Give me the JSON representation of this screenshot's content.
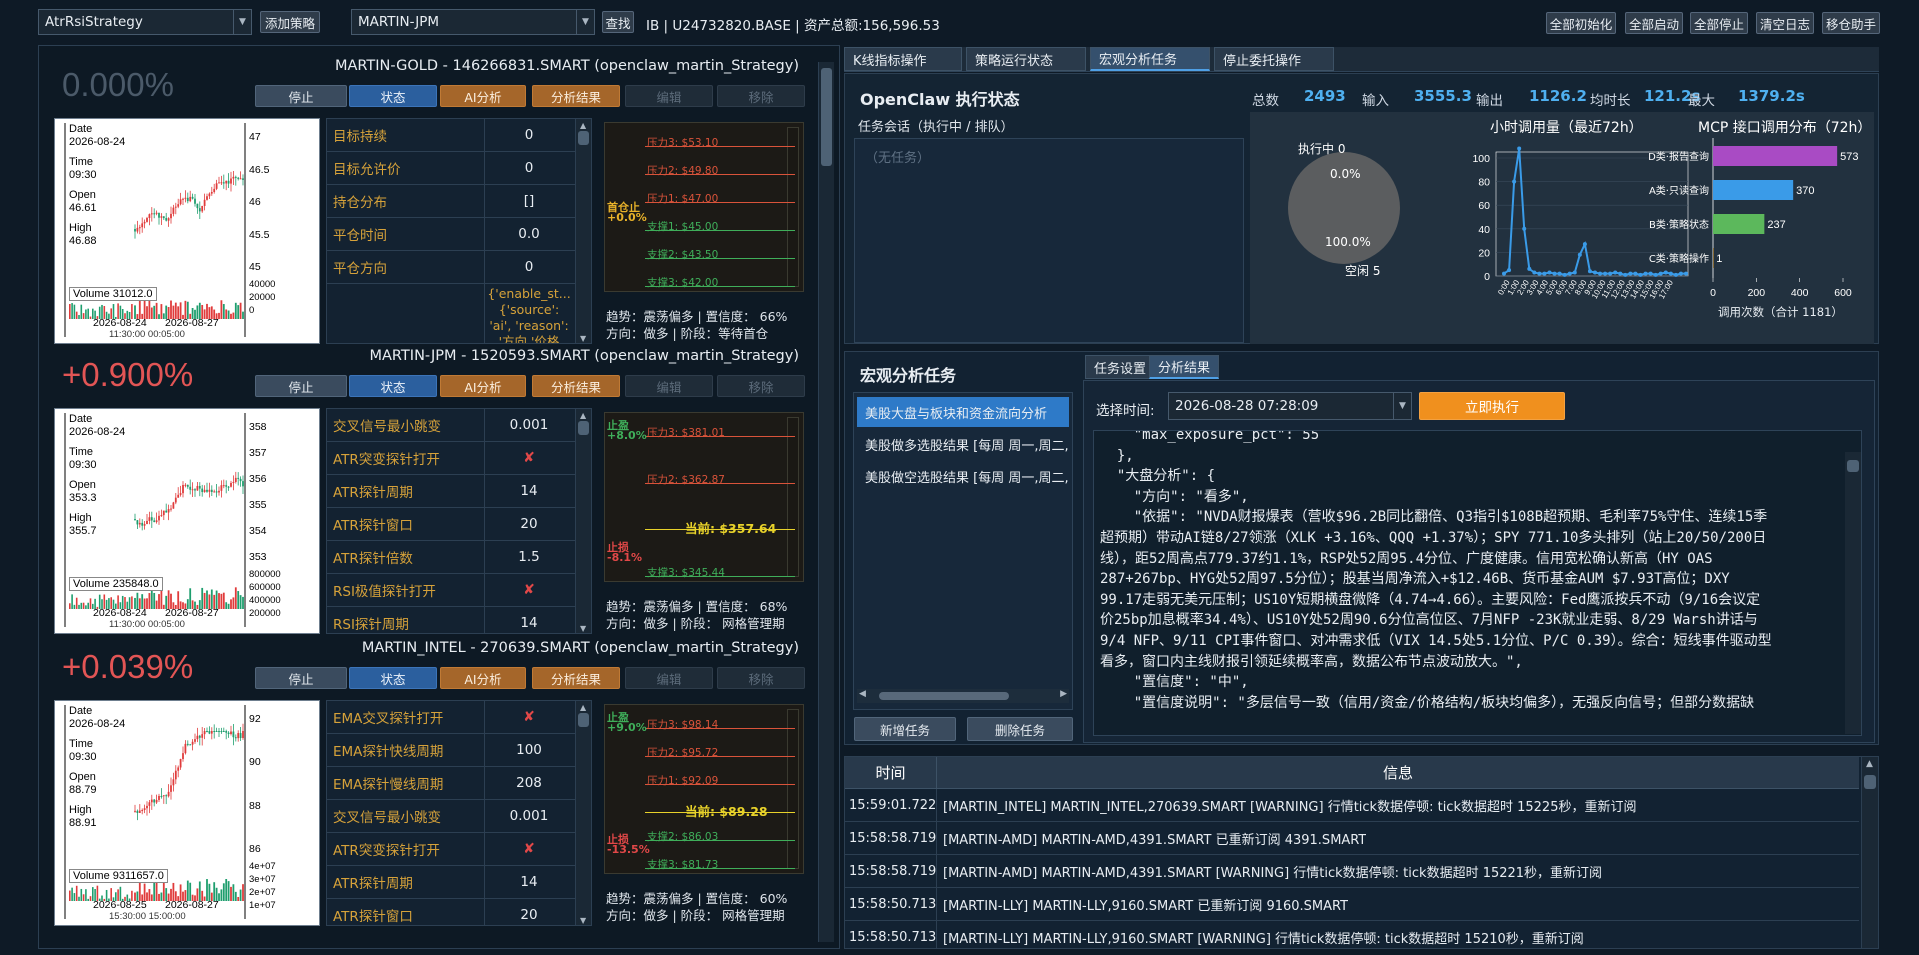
{
  "toolbar": {
    "strategy_combo": "AtrRsiStrategy",
    "add_strategy": "添加策略",
    "symbol_combo": "MARTIN-JPM",
    "find": "查找",
    "account_info": "IB | U24732820.BASE | 资产总额:156,596.53",
    "init_all": "全部初始化",
    "start_all": "全部启动",
    "stop_all": "全部停止",
    "clear_log": "清空日志",
    "move_helper": "移仓助手"
  },
  "card_buttons": {
    "stop": "停止",
    "status": "状态",
    "ai": "AI分析",
    "result": "分析结果",
    "edit": "编辑",
    "remove": "移除"
  },
  "strategies": [
    {
      "pct": "0.000%",
      "pct_color": "#4b5a69",
      "title": "MARTIN-GOLD  -  146266831.SMART  (openclaw_martin_Strategy)",
      "kline": {
        "date_label": "Date",
        "date": "2026-08-24",
        "time_label": "Time",
        "time": "09:30",
        "open_label": "Open",
        "open": "46.61",
        "high_label": "High",
        "high": "46.88",
        "y_ticks": [
          "47",
          "46.5",
          "46",
          "45.5",
          "45"
        ],
        "vol_label": "Volume 31012.0",
        "vol_ticks": [
          "40000",
          "20000",
          "0"
        ],
        "x_labels": [
          "2026-08-24",
          "2026-08-27"
        ],
        "x_sub": "11:30:00 00:05:00"
      },
      "params": [
        {
          "k": "目标持续",
          "v": "0"
        },
        {
          "k": "目标允许价",
          "v": "0"
        },
        {
          "k": "持仓分布",
          "v": "[]"
        },
        {
          "k": "平仓时间",
          "v": "0.0"
        },
        {
          "k": "平仓方向",
          "v": "0"
        }
      ],
      "extra": [
        "{'enable_st...",
        "{'source':",
        "'ai', 'reason':",
        "'方向 '价格"
      ],
      "levels": [
        {
          "t": "压力3: $53.10",
          "c": "#d9533a"
        },
        {
          "t": "压力2: $49.80",
          "c": "#d9533a"
        },
        {
          "t": "压力1: $47.00",
          "c": "#d9533a"
        },
        {
          "t": "支撑1: $45.00",
          "c": "#3fae5a"
        },
        {
          "t": "支撑2: $43.50",
          "c": "#3fae5a"
        },
        {
          "t": "支撑3: $42.00",
          "c": "#3fae5a"
        }
      ],
      "tags": [
        {
          "t": "首仓止",
          "c": "#e8b22a"
        },
        {
          "t": "+0.0%",
          "c": "#e8b22a"
        }
      ],
      "trend": "趋势：震荡偏多 | 置信度： 66%",
      "dir": "方向：做多 | 阶段：等待首仓"
    },
    {
      "pct": "+0.900%",
      "pct_color": "#e25555",
      "title": "MARTIN-JPM  -  1520593.SMART  (openclaw_martin_Strategy)",
      "kline": {
        "date_label": "Date",
        "date": "2026-08-24",
        "time_label": "Time",
        "time": "09:30",
        "open_label": "Open",
        "open": "353.3",
        "high_label": "High",
        "high": "355.7",
        "y_ticks": [
          "358",
          "357",
          "356",
          "355",
          "354",
          "353"
        ],
        "vol_label": "Volume 235848.0",
        "vol_ticks": [
          "800000",
          "600000",
          "400000",
          "200000"
        ],
        "x_labels": [
          "2026-08-24",
          "2026-08-27"
        ],
        "x_sub": "11:30:00 00:05:00"
      },
      "params": [
        {
          "k": "交叉信号最小跳变",
          "v": "0.001"
        },
        {
          "k": "ATR突变探针打开",
          "v": "✘"
        },
        {
          "k": "ATR探针周期",
          "v": "14"
        },
        {
          "k": "ATR探针窗口",
          "v": "20"
        },
        {
          "k": "ATR探针倍数",
          "v": "1.5"
        },
        {
          "k": "RSI极值探针打开",
          "v": "✘"
        },
        {
          "k": "RSI探针周期",
          "v": "14"
        }
      ],
      "levels": [
        {
          "t": "压力3: $381.01",
          "c": "#d9533a"
        },
        {
          "t": "压力2: $362.87",
          "c": "#d9533a"
        },
        {
          "t": "当前: $357.64",
          "c": "#e8d22a"
        },
        {
          "t": "支撑3: $345.44",
          "c": "#3fae5a"
        }
      ],
      "tags": [
        {
          "t": "止盈",
          "c": "#3fae5a"
        },
        {
          "t": "+8.0%",
          "c": "#3fae5a"
        },
        {
          "t": "止损",
          "c": "#e24848"
        },
        {
          "t": "-8.1%",
          "c": "#e24848"
        }
      ],
      "trend": "趋势：震荡偏多 | 置信度： 68%",
      "dir": "方向：做多 | 阶段： 网格管理期"
    },
    {
      "pct": "+0.039%",
      "pct_color": "#e25555",
      "title": "MARTIN_INTEL  -  270639.SMART  (openclaw_martin_Strategy)",
      "kline": {
        "date_label": "Date",
        "date": "2026-08-24",
        "time_label": "Time",
        "time": "09:30",
        "open_label": "Open",
        "open": "88.79",
        "high_label": "High",
        "high": "88.91",
        "y_ticks": [
          "92",
          "90",
          "88",
          "86"
        ],
        "vol_label": "Volume 9311657.0",
        "vol_ticks": [
          "4e+07",
          "3e+07",
          "2e+07",
          "1e+07"
        ],
        "x_labels": [
          "2026-08-25",
          "2026-08-27"
        ],
        "x_sub": "15:30:00 15:00:00"
      },
      "params": [
        {
          "k": "EMA交叉探针打开",
          "v": "✘"
        },
        {
          "k": "EMA探针快线周期",
          "v": "100"
        },
        {
          "k": "EMA探针慢线周期",
          "v": "208"
        },
        {
          "k": "交叉信号最小跳变",
          "v": "0.001"
        },
        {
          "k": "ATR突变探针打开",
          "v": "✘"
        },
        {
          "k": "ATR探针周期",
          "v": "14"
        },
        {
          "k": "ATR探针窗口",
          "v": "20"
        }
      ],
      "levels": [
        {
          "t": "压力3: $98.14",
          "c": "#d9533a"
        },
        {
          "t": "压力2: $95.72",
          "c": "#d9533a"
        },
        {
          "t": "压力1: $92.09",
          "c": "#d9533a"
        },
        {
          "t": "当前: $89.28",
          "c": "#e8d22a"
        },
        {
          "t": "支撑2: $86.03",
          "c": "#3fae5a"
        },
        {
          "t": "支撑3: $81.73",
          "c": "#3fae5a"
        }
      ],
      "tags": [
        {
          "t": "止盈",
          "c": "#3fae5a"
        },
        {
          "t": "+9.0%",
          "c": "#3fae5a"
        },
        {
          "t": "止损",
          "c": "#e24848"
        },
        {
          "t": "-13.5%",
          "c": "#e24848"
        }
      ],
      "trend": "趋势：震荡偏多 | 置信度： 60%",
      "dir": "方向：做多 | 阶段： 网格管理期"
    }
  ],
  "right_tabs": [
    "K线指标操作",
    "策略运行状态",
    "宏观分析任务",
    "停止委托操作"
  ],
  "openclaw": {
    "title": "OpenClaw 执行状态",
    "sub": "任务会话（执行中 / 排队）",
    "empty": "（无任务）",
    "stats": [
      {
        "k": "总数",
        "v": "2493"
      },
      {
        "k": "输入",
        "v": "3555.3"
      },
      {
        "k": "输出",
        "v": "1126.2"
      },
      {
        "k": "均时长",
        "v": "121.2s"
      },
      {
        "k": "最大",
        "v": "1379.2s"
      }
    ],
    "pie": {
      "top": "执行中 0",
      "a": "0.0%",
      "b": "100.0%",
      "idle": "空闲 5"
    },
    "hourly": {
      "title": "小时调用量（最近72h）",
      "y_ticks": [
        "100",
        "80",
        "60",
        "40",
        "20",
        "0"
      ],
      "x_ticks": [
        "0:00",
        "1:00",
        "2:00",
        "3:00",
        "4:00",
        "5:00",
        "6:00",
        "7:00",
        "8:00",
        "9:00",
        "10:00",
        "11:00",
        "12:00",
        "13:00",
        "14:00",
        "15:00",
        "16:00",
        "17:00"
      ]
    },
    "mcp": {
      "title": "MCP 接口调用分布（72h）",
      "footer": "调用次数（合计 1181）",
      "x_ticks": [
        "0",
        "200",
        "400",
        "600"
      ],
      "bars": [
        {
          "k": "D类·报告查询",
          "v": 573,
          "c": "#a94bc4"
        },
        {
          "k": "A类·只读查询",
          "v": 370,
          "c": "#3a9be8"
        },
        {
          "k": "B类·策略状态",
          "v": 237,
          "c": "#5cb85c"
        },
        {
          "k": "C类·策略操作",
          "v": 1,
          "c": "#e0a030"
        }
      ]
    }
  },
  "macro": {
    "title": "宏观分析任务",
    "tasks": [
      "美股大盘与板块和资金流向分析",
      "美股做多选股结果 [每周 周一,周二,",
      "美股做空选股结果 [每周 周一,周二,"
    ],
    "new": "新增任务",
    "del": "删除任务",
    "sub_tabs": [
      "任务设置",
      "分析结果"
    ],
    "time_label": "选择时间:",
    "time_value": "2026-08-28 07:28:09",
    "run": "立即执行",
    "json_lines": [
      "    \"max_exposure_pct\": 55",
      "  },",
      "  \"大盘分析\": {",
      "    \"方向\": \"看多\",",
      "    \"依据\": \"NVDA财报爆表（营收$96.2B同比翻倍、Q3指引$108B超预期、毛利率75%守住、连续15季",
      "超预期）带动AI链8/27领涨（XLK +3.16%、QQQ +1.37%）；SPY 771.10多头排列（站上20/50/200日",
      "线），距52周高点779.37约1.1%，RSP处52周95.4分位、广度健康。信用宽松确认新高（HY OAS",
      "287+267bp、HYG处52周97.5分位）；股基当周净流入+$12.46B、货币基金AUM $7.93T高位；DXY",
      "99.17走弱无美元压制；US10Y短期横盘微降（4.74→4.66）。主要风险：Fed鹰派按兵不动（9/16会议定",
      "价25bp加息概率34.4%）、US10Y处52周90.6分位高位区、7月NFP -23K就业走弱、8/29 Warsh讲话与",
      "9/4 NFP、9/11 CPI事件窗口、对冲需求低（VIX 14.5处5.1分位、P/C 0.39）。综合：短线事件驱动型",
      "看多，窗口内主线财报引领延续概率高，数据公布节点波动放大。\",",
      "    \"置信度\": \"中\",",
      "    \"置信度说明\": \"多层信号一致（信用/资金/价格结构/板块均偏多），无强反向信号；但部分数据缺"
    ]
  },
  "log": {
    "h_time": "时间",
    "h_msg": "信息",
    "rows": [
      {
        "t": "15:59:01.722",
        "m": "[MARTIN_INTEL]  MARTIN_INTEL,270639.SMART [WARNING] 行情tick数据停顿: tick数据超时 15225秒，重新订阅"
      },
      {
        "t": "15:58:58.719",
        "m": "[MARTIN-AMD]  MARTIN-AMD,4391.SMART 已重新订阅 4391.SMART"
      },
      {
        "t": "15:58:58.719",
        "m": "[MARTIN-AMD]  MARTIN-AMD,4391.SMART [WARNING] 行情tick数据停顿: tick数据超时 15221秒，重新订阅"
      },
      {
        "t": "15:58:50.713",
        "m": "[MARTIN-LLY]  MARTIN-LLY,9160.SMART 已重新订阅 9160.SMART"
      },
      {
        "t": "15:58:50.713",
        "m": "[MARTIN-LLY]  MARTIN-LLY,9160.SMART [WARNING] 行情tick数据停顿: tick数据超时 15210秒，重新订阅"
      }
    ]
  },
  "colors": {
    "bg": "#0e1a26",
    "accent": "#4fa0e6",
    "up": "#e25555",
    "down": "#3fae5a",
    "param_key": "#d6a23a",
    "run": "#f0901e"
  }
}
